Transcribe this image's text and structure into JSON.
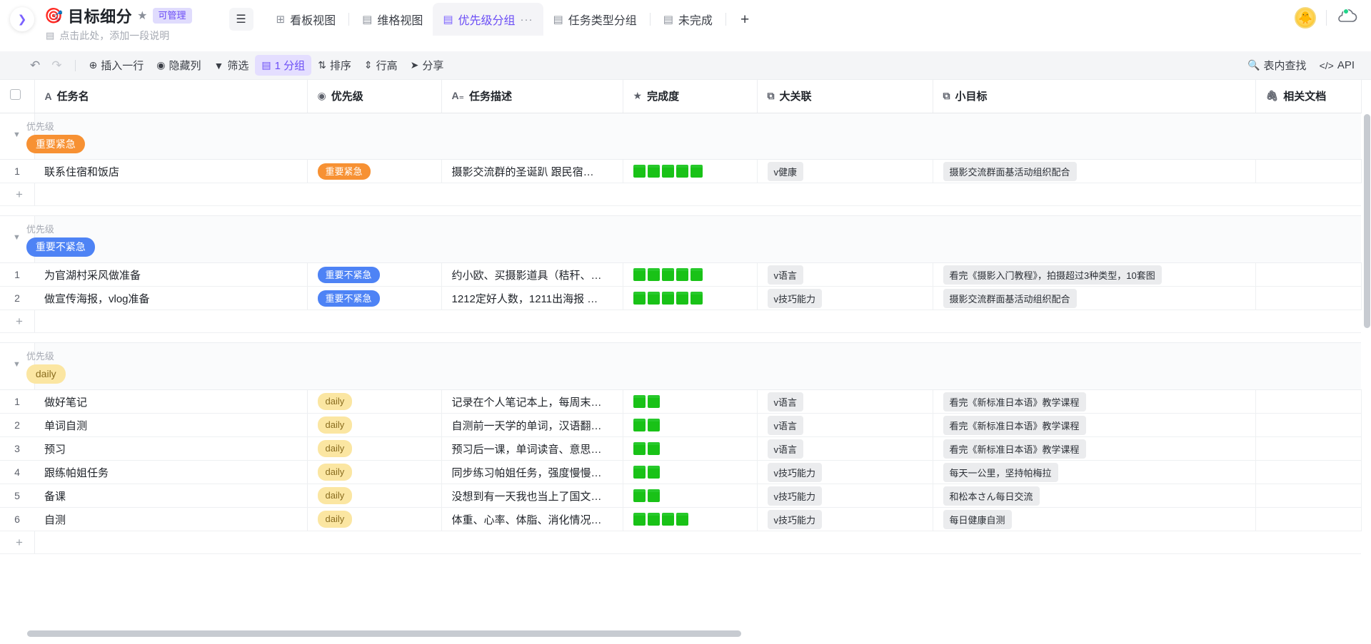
{
  "header": {
    "collapse_icon": "chevron-right-icon",
    "doc_emoji": "🎯",
    "title": "目标细分",
    "star_icon": "★",
    "manage_badge": "可管理",
    "subtitle_icon": "▤",
    "subtitle": "点击此处，添加一段说明",
    "menu_icon": "☰",
    "tabs": [
      {
        "label": "看板视图",
        "icon": "kanban-icon",
        "active": false
      },
      {
        "label": "维格视图",
        "icon": "grid-icon",
        "active": false
      },
      {
        "label": "优先级分组",
        "icon": "grid-icon",
        "active": true,
        "more": "···"
      },
      {
        "label": "任务类型分组",
        "icon": "grid-icon",
        "active": false
      },
      {
        "label": "未完成",
        "icon": "grid-icon",
        "active": false
      }
    ],
    "add_tab": "+",
    "avatar_emoji": "🐥",
    "cloud_icon": "cloud-icon"
  },
  "toolbar": {
    "undo": "↶",
    "redo": "↷",
    "items": [
      {
        "label": "插入一行",
        "icon": "⊕",
        "active": false
      },
      {
        "label": "隐藏列",
        "icon": "◉",
        "active": false
      },
      {
        "label": "筛选",
        "icon": "▼",
        "active": false
      },
      {
        "label": "1 分组",
        "icon": "▤",
        "active": true
      },
      {
        "label": "排序",
        "icon": "⇅",
        "active": false
      },
      {
        "label": "行高",
        "icon": "⇕",
        "active": false
      },
      {
        "label": "分享",
        "icon": "➤",
        "active": false
      }
    ],
    "right_items": [
      {
        "label": "表内查找",
        "icon": "🔍"
      },
      {
        "label": "API",
        "icon": "</>"
      }
    ]
  },
  "table": {
    "columns": [
      {
        "key": "chk",
        "label": "",
        "icon": "checkbox-icon"
      },
      {
        "key": "name",
        "label": "任务名",
        "icon": "A"
      },
      {
        "key": "pri",
        "label": "优先级",
        "icon": "◉"
      },
      {
        "key": "desc",
        "label": "任务描述",
        "icon": "A₌"
      },
      {
        "key": "done",
        "label": "完成度",
        "icon": "★"
      },
      {
        "key": "big",
        "label": "大关联",
        "icon": "⧉"
      },
      {
        "key": "small",
        "label": "小目标",
        "icon": "⧉"
      },
      {
        "key": "doc",
        "label": "相关文档",
        "icon": "🖇"
      }
    ],
    "group_label": "优先级",
    "add_row_label": "+",
    "groups": [
      {
        "name": "重要紧急",
        "color_bg": "#f79133",
        "color_fg": "#ffffff",
        "rows": [
          {
            "index": "1",
            "name": "联系住宿和饭店",
            "priority": "重要紧急",
            "desc": "摄影交流群的圣诞趴 跟民宿…",
            "done": 5,
            "big": "v健康",
            "small": "摄影交流群面基活动组织配合"
          }
        ]
      },
      {
        "name": "重要不紧急",
        "color_bg": "#4e83f5",
        "color_fg": "#ffffff",
        "rows": [
          {
            "index": "1",
            "name": "为官湖村采风做准备",
            "priority": "重要不紧急",
            "desc": "约小欧、买摄影道具（秸秆、…",
            "done": 5,
            "big": "v语言",
            "small": "看完《摄影入门教程》，拍摄超过3种类型，10套图"
          },
          {
            "index": "2",
            "name": "做宣传海报，vlog准备",
            "priority": "重要不紧急",
            "desc": "1212定好人数，1211出海报 …",
            "done": 5,
            "big": "v技巧能力",
            "small": "摄影交流群面基活动组织配合"
          }
        ]
      },
      {
        "name": "daily",
        "color_bg": "#fbe6a2",
        "color_fg": "#8a6d1f",
        "rows": [
          {
            "index": "1",
            "name": "做好笔记",
            "priority": "daily",
            "desc": "记录在个人笔记本上，每周末…",
            "done": 2,
            "big": "v语言",
            "small": "看完《新标准日本语》教学课程"
          },
          {
            "index": "2",
            "name": "单词自测",
            "priority": "daily",
            "desc": "自测前一天学的单词，汉语翻…",
            "done": 2,
            "big": "v语言",
            "small": "看完《新标准日本语》教学课程"
          },
          {
            "index": "3",
            "name": "预习",
            "priority": "daily",
            "desc": "预习后一课，单词读音、意思…",
            "done": 2,
            "big": "v语言",
            "small": "看完《新标准日本语》教学课程"
          },
          {
            "index": "4",
            "name": "跟练帕姐任务",
            "priority": "daily",
            "desc": "同步练习帕姐任务，强度慢慢…",
            "done": 2,
            "big": "v技巧能力",
            "small": "每天一公里，坚持帕梅拉"
          },
          {
            "index": "5",
            "name": "备课",
            "priority": "daily",
            "desc": "没想到有一天我也当上了国文…",
            "done": 2,
            "big": "v技巧能力",
            "small": "和松本さん每日交流"
          },
          {
            "index": "6",
            "name": "自测",
            "priority": "daily",
            "desc": "体重、心率、体脂、消化情况…",
            "done": 4,
            "big": "v技巧能力",
            "small": "每日健康自测"
          }
        ]
      }
    ]
  }
}
